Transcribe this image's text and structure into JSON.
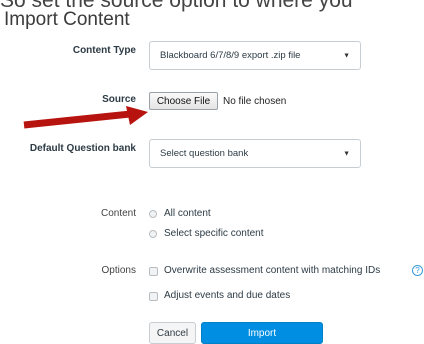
{
  "top_cut_text": "So set the source option to where you",
  "page": {
    "title": "Import Content"
  },
  "form": {
    "content_type": {
      "label": "Content Type",
      "selected": "Blackboard 6/7/8/9 export .zip file"
    },
    "source": {
      "label": "Source",
      "button_label": "Choose File",
      "status": "No file chosen"
    },
    "question_bank": {
      "label": "Default Question bank",
      "placeholder": "Select question bank"
    },
    "content": {
      "label": "Content",
      "options": [
        "All content",
        "Select specific content"
      ]
    },
    "options": {
      "label": "Options",
      "items": [
        "Overwrite assessment content with matching IDs",
        "Adjust events and due dates"
      ],
      "help_glyph": "?"
    }
  },
  "actions": {
    "cancel_label": "Cancel",
    "import_label": "Import"
  },
  "annotation": {
    "arrow_color": "#b8140f"
  },
  "colors": {
    "primary": "#008ee2",
    "text": "#2d3b45",
    "help": "#3a9bd8"
  }
}
